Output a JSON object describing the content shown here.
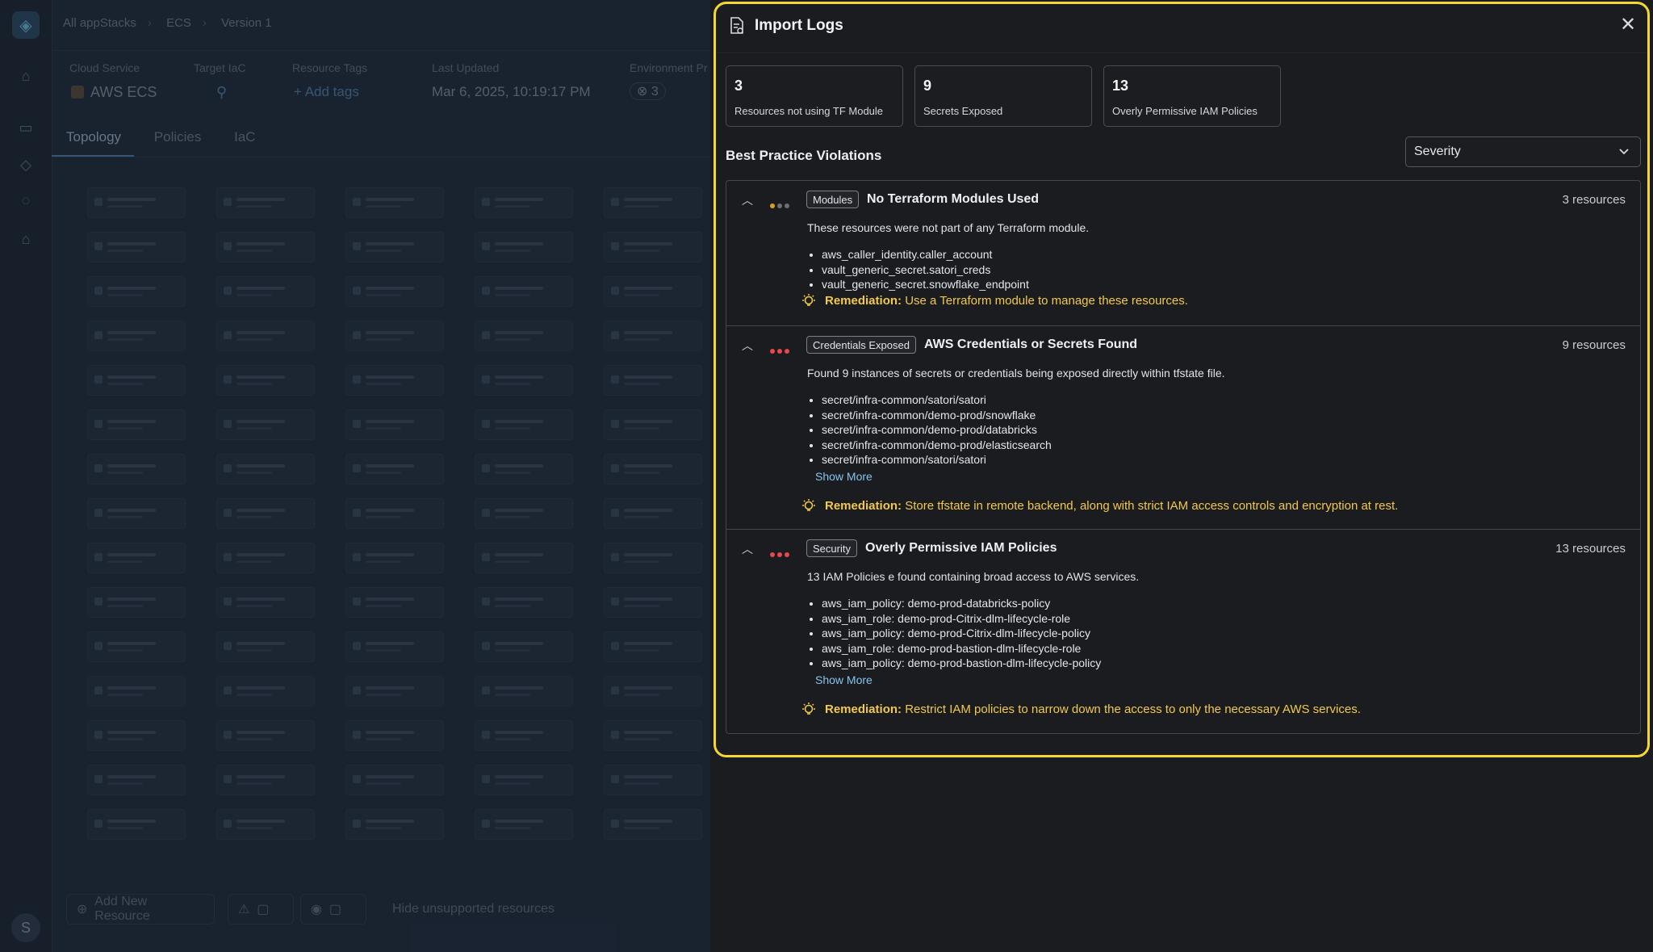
{
  "background": {
    "breadcrumbs": [
      "All appStacks",
      "ECS",
      "Version 1"
    ],
    "meta_labels": [
      "Cloud Service",
      "Target IaC",
      "Resource Tags",
      "Last Updated",
      "Environment Pr"
    ],
    "cloud_service": "AWS ECS",
    "add_tags": "+ Add tags",
    "last_updated": "Mar 6, 2025, 10:19:17 PM",
    "env_count": "3",
    "tabs": [
      "Topology",
      "Policies",
      "IaC"
    ],
    "add_resource": "Add New Resource",
    "hide_unsupported": "Hide unsupported resources",
    "user_initial": "S"
  },
  "drawer": {
    "title": "Import Logs",
    "stats": [
      {
        "num": "3",
        "label": "Resources not using TF Module"
      },
      {
        "num": "9",
        "label": "Secrets Exposed"
      },
      {
        "num": "13",
        "label": "Overly Permissive IAM Policies"
      }
    ],
    "section_title": "Best Practice Violations",
    "severity_select": "Severity",
    "violations": [
      {
        "tag": "Modules",
        "title": "No Terraform Modules Used",
        "count": "3 resources",
        "severity_colors": [
          "#d9a21e",
          "#6b6e74",
          "#6b6e74"
        ],
        "description": "These resources were not part of any Terraform module.",
        "items": [
          "aws_caller_identity.caller_account",
          "vault_generic_secret.satori_creds",
          "vault_generic_secret.snowflake_endpoint"
        ],
        "show_more": "",
        "remediation_label": "Remediation:",
        "remediation": "Use a Terraform module to manage these resources."
      },
      {
        "tag": "Credentials Exposed",
        "title": "AWS Credentials or Secrets Found",
        "count": "9 resources",
        "severity_colors": [
          "#e5484d",
          "#e5484d",
          "#e5484d"
        ],
        "description": "Found 9 instances of secrets or credentials being exposed directly within tfstate file.",
        "items": [
          "secret/infra-common/satori/satori",
          "secret/infra-common/demo-prod/snowflake",
          "secret/infra-common/demo-prod/databricks",
          "secret/infra-common/demo-prod/elasticsearch",
          "secret/infra-common/satori/satori"
        ],
        "show_more": "Show More",
        "remediation_label": "Remediation:",
        "remediation": "Store tfstate in remote backend, along with strict IAM access controls and encryption at rest."
      },
      {
        "tag": "Security",
        "title": "Overly Permissive IAM Policies",
        "count": "13 resources",
        "severity_colors": [
          "#e5484d",
          "#e5484d",
          "#e5484d"
        ],
        "description": "13 IAM Policies e found containing broad access to AWS services.",
        "items": [
          "aws_iam_policy: demo-prod-databricks-policy",
          "aws_iam_role: demo-prod-Citrix-dlm-lifecycle-role",
          "aws_iam_policy: demo-prod-Citrix-dlm-lifecycle-policy",
          "aws_iam_role: demo-prod-bastion-dlm-lifecycle-role",
          "aws_iam_policy: demo-prod-bastion-dlm-lifecycle-policy"
        ],
        "show_more": "Show More",
        "remediation_label": "Remediation:",
        "remediation": "Restrict IAM policies to narrow down the access to only the necessary AWS services."
      }
    ]
  },
  "colors": {
    "highlight_border": "#f3d92f",
    "remediation": "#f2c94c",
    "link": "#86c4ee"
  }
}
